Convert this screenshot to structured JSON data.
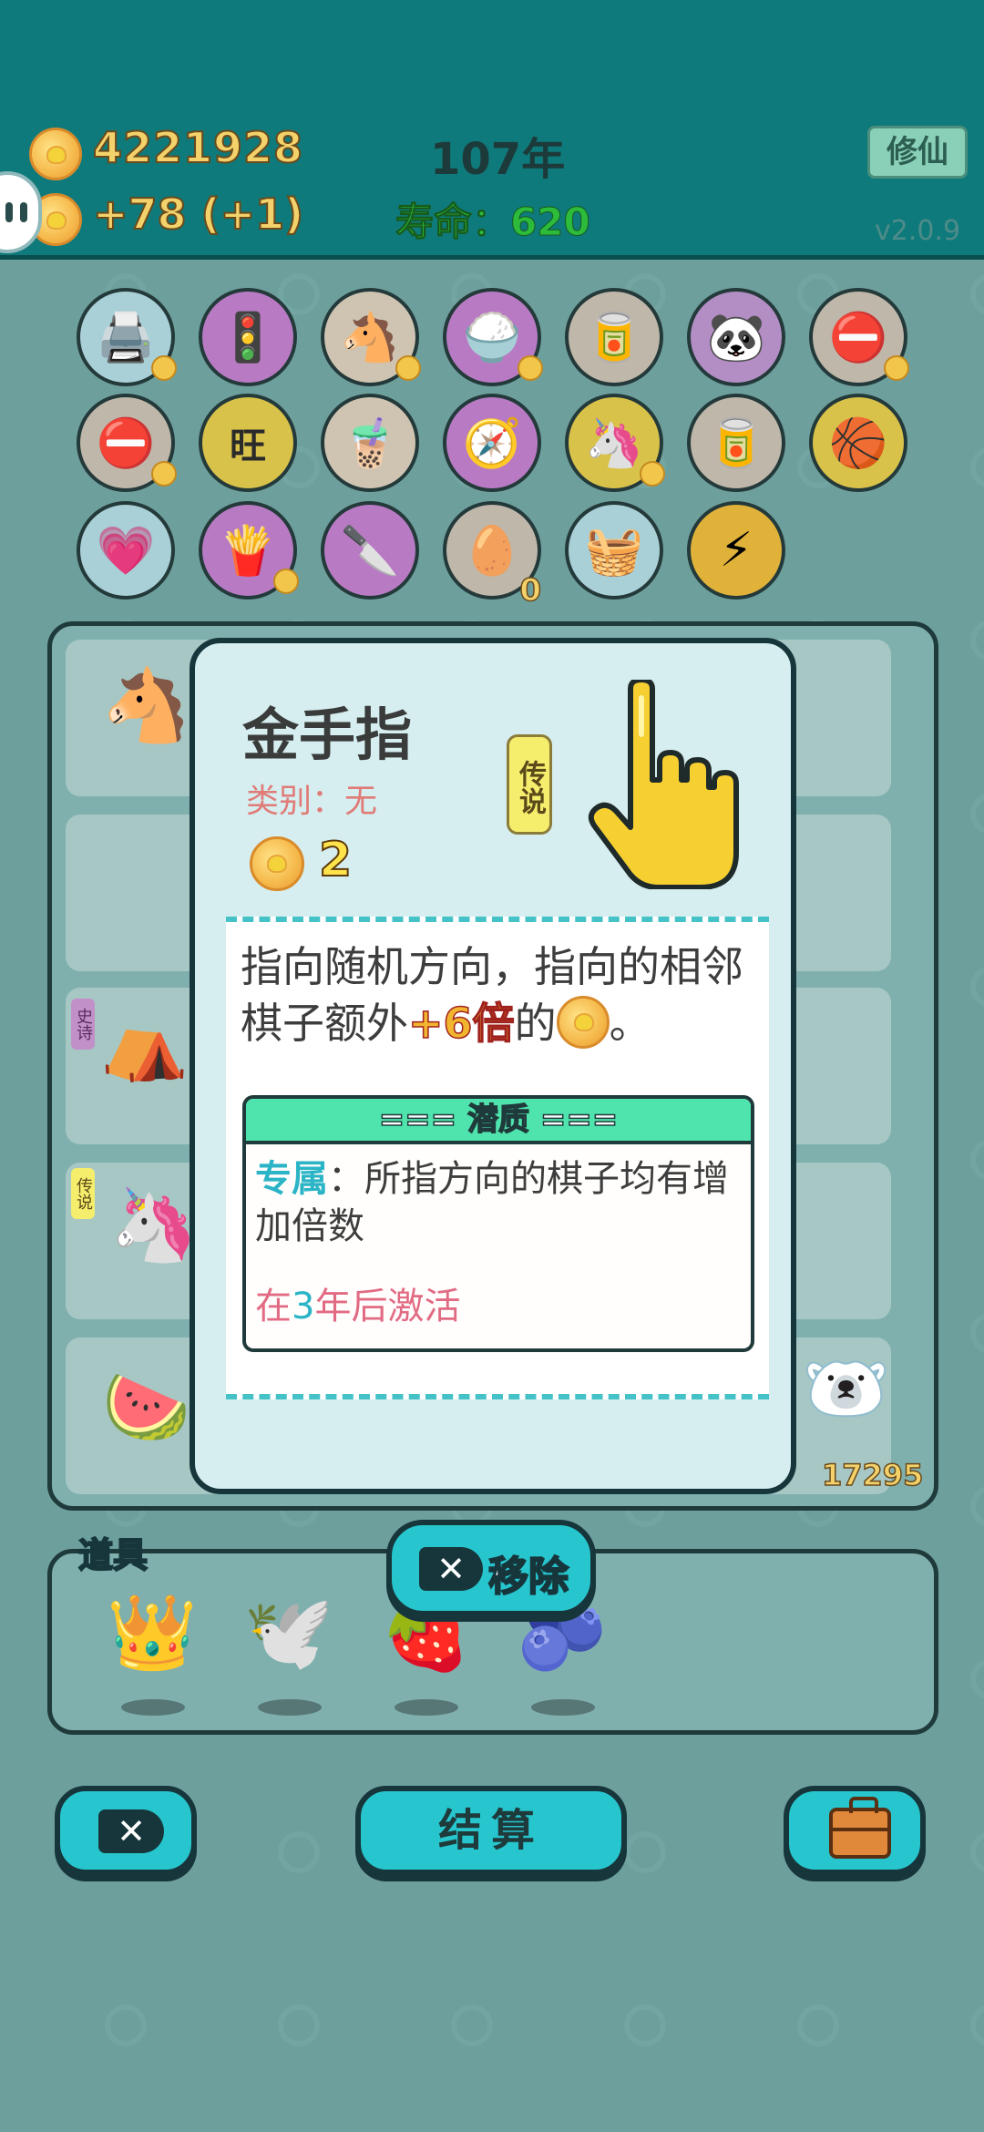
{
  "header": {
    "money": "4221928",
    "income": "+78 (+1)",
    "year": "107年",
    "life": "寿命：620",
    "xiuxian_label": "修仙",
    "version": "v2.0.9"
  },
  "items": [
    {
      "icon": "🖨️",
      "name": "printer"
    },
    {
      "icon": "🚦",
      "name": "traffic-light"
    },
    {
      "icon": "🐴",
      "name": "horses"
    },
    {
      "icon": "🍚",
      "name": "rice-bowl"
    },
    {
      "icon": "🥫",
      "name": "pet-food-bowl"
    },
    {
      "icon": "🐼",
      "name": "panda"
    },
    {
      "icon": "⛔",
      "name": "remove-sign"
    },
    {
      "icon": "⛔",
      "name": "remove-sign"
    },
    {
      "icon": "旺",
      "name": "wang-tiles"
    },
    {
      "icon": "🧋",
      "name": "bubble-tea"
    },
    {
      "icon": "🧭",
      "name": "compass"
    },
    {
      "icon": "🦄",
      "name": "unicorn"
    },
    {
      "icon": "🥫",
      "name": "pet-food-bowl"
    },
    {
      "icon": "🏀",
      "name": "basketballs"
    },
    {
      "icon": "💗",
      "name": "heart-fan"
    },
    {
      "icon": "🍟",
      "name": "fries"
    },
    {
      "icon": "🔪",
      "name": "cleaver"
    },
    {
      "icon": "🥚",
      "name": "egg-tray"
    },
    {
      "icon": "🧺",
      "name": "bag"
    },
    {
      "icon": "⚡",
      "name": "lightning"
    }
  ],
  "egg_count": "0",
  "board": {
    "left_tag_1": "史诗",
    "left_tag_2": "传说",
    "value_right": "17295"
  },
  "card": {
    "title": "金手指",
    "category": "类别：无",
    "rarity": "传说",
    "price": "2",
    "desc_1": "指向随机方向，指向的相邻棋子额外",
    "desc_highlight": "+6倍",
    "desc_2": "的",
    "desc_3": "。",
    "potential_header": "=== 潜质 ===",
    "potential_key": "专属",
    "potential_text": "：所指方向的棋子均有增加倍数",
    "activate_prefix": "在",
    "activate_num": "3",
    "activate_suffix": "年后激活"
  },
  "remove_label": "移除",
  "tools": {
    "label": "道具",
    "list": [
      "crown",
      "bird",
      "strawberry",
      "blueberry"
    ]
  },
  "buttons": {
    "settle": "结算"
  }
}
